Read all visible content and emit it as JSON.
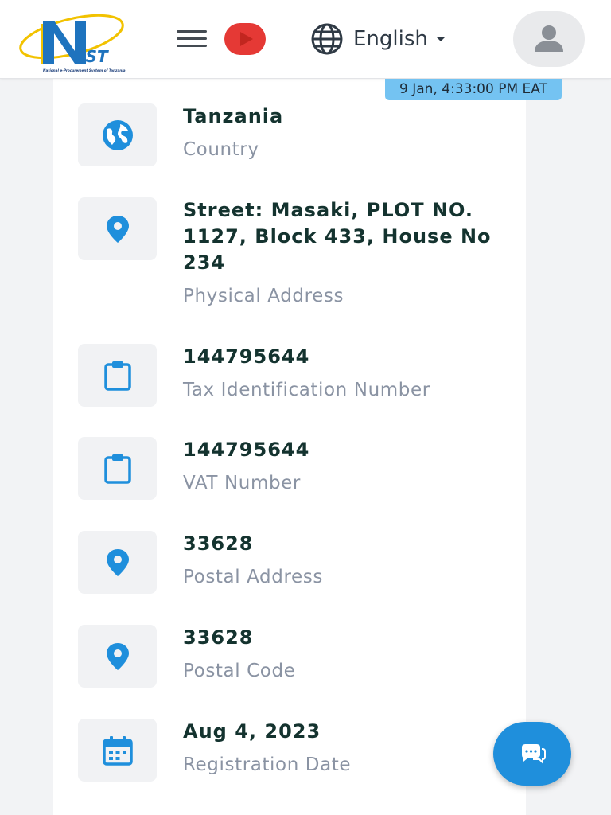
{
  "header": {
    "logo_text": "NeST",
    "logo_subtext": "National e-Procurement System of Tanzania",
    "language_label": "English",
    "timestamp": "9 Jan, 4:33:00 PM EAT"
  },
  "colors": {
    "accent_blue": "#1f8fdc",
    "youtube_red": "#e53935",
    "timestamp_bg": "#74c3f2",
    "value_text": "#14332f",
    "label_text": "#8a93a3"
  },
  "details": [
    {
      "icon": "globe-icon",
      "value": "Tanzania",
      "label": "Country"
    },
    {
      "icon": "location-pin-icon",
      "value": "Street: Masaki, PLOT NO. 1127, Block 433, House No 234",
      "label": "Physical Address"
    },
    {
      "icon": "clipboard-icon",
      "value": "144795644",
      "label": "Tax Identification Number"
    },
    {
      "icon": "clipboard-icon",
      "value": "144795644",
      "label": "VAT Number"
    },
    {
      "icon": "location-pin-icon",
      "value": "33628",
      "label": "Postal Address"
    },
    {
      "icon": "location-pin-icon",
      "value": "33628",
      "label": "Postal Code"
    },
    {
      "icon": "calendar-icon",
      "value": "Aug 4, 2023",
      "label": "Registration Date"
    }
  ]
}
